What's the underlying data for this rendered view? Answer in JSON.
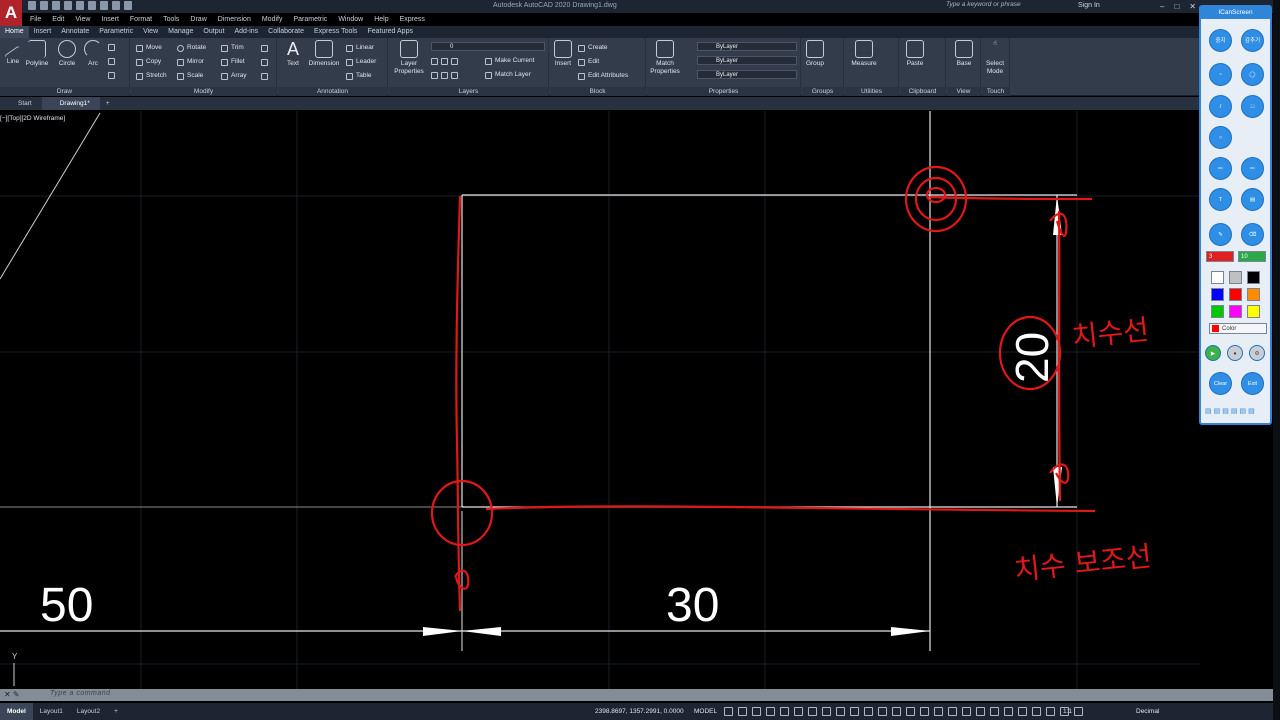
{
  "app": {
    "logo_letter": "A",
    "window_title": "Autodesk AutoCAD 2020    Drawing1.dwg",
    "search_placeholder": "Type a keyword or phrase",
    "sign_in": "Sign In"
  },
  "menu": [
    "File",
    "Edit",
    "View",
    "Insert",
    "Format",
    "Tools",
    "Draw",
    "Dimension",
    "Modify",
    "Parametric",
    "Window",
    "Help",
    "Express"
  ],
  "ribbon_tabs": [
    "Home",
    "Insert",
    "Annotate",
    "Parametric",
    "View",
    "Manage",
    "Output",
    "Add-ins",
    "Collaborate",
    "Express Tools",
    "Featured Apps"
  ],
  "ribbon": {
    "draw": {
      "title": "Draw",
      "line": "Line",
      "polyline": "Polyline",
      "circle": "Circle",
      "arc": "Arc"
    },
    "modify": {
      "title": "Modify",
      "move": "Move",
      "rotate": "Rotate",
      "trim": "Trim",
      "copy": "Copy",
      "mirror": "Mirror",
      "fillet": "Fillet",
      "stretch": "Stretch",
      "scale": "Scale",
      "array": "Array"
    },
    "annotation": {
      "title": "Annotation",
      "text": "Text",
      "dimension": "Dimension",
      "linear": "Linear",
      "leader": "Leader",
      "table": "Table"
    },
    "layers": {
      "title": "Layers",
      "layer_properties_1": "Layer",
      "layer_properties_2": "Properties",
      "current_layer": "0",
      "make_current": "Make Current",
      "match_layer": "Match Layer"
    },
    "block": {
      "title": "Block",
      "insert": "Insert",
      "create": "Create",
      "edit": "Edit",
      "edit_attributes": "Edit Attributes"
    },
    "properties": {
      "title": "Properties",
      "match_1": "Match",
      "match_2": "Properties",
      "color": "ByLayer",
      "linetype": "ByLayer",
      "lineweight": "ByLayer"
    },
    "groups": {
      "title": "Groups",
      "group": "Group"
    },
    "utilities": {
      "title": "Utilities",
      "measure": "Measure"
    },
    "clipboard": {
      "title": "Clipboard",
      "paste": "Paste"
    },
    "view": {
      "title": "View",
      "base": "Base"
    },
    "touch": {
      "title": "Touch",
      "select_mode_1": "Select",
      "select_mode_2": "Mode"
    }
  },
  "file_tabs": [
    "Start",
    "Drawing1*"
  ],
  "viewport_label": "[−][Top][2D Wireframe]",
  "drawing": {
    "dim_left": "50",
    "dim_bottom": "30",
    "dim_right": "20",
    "note_dimension_line": "치수선",
    "note_extension_line": "치수 보조선",
    "ucs_y": "Y"
  },
  "command_placeholder": "Type a command",
  "status": {
    "layouts": [
      "Model",
      "Layout1",
      "Layout2"
    ],
    "coordinates": "2398.8697, 1357.2991, 0.0000",
    "space": "MODEL",
    "scale": "1:1",
    "units": "Decimal"
  },
  "icanscreen": {
    "title": "ICanScreen",
    "stop_label": "중지",
    "hide_label": "감추기",
    "pen_size": "3",
    "eraser_size": "10",
    "color_label": "Color",
    "clear_label": "Clear",
    "exit_label": "Exit",
    "palette": [
      "#ffffff",
      "#c0c0c0",
      "#000000",
      "#0000ff",
      "#ff0000",
      "#ff8c00",
      "#00c800",
      "#ff00ff",
      "#ffff00"
    ]
  }
}
